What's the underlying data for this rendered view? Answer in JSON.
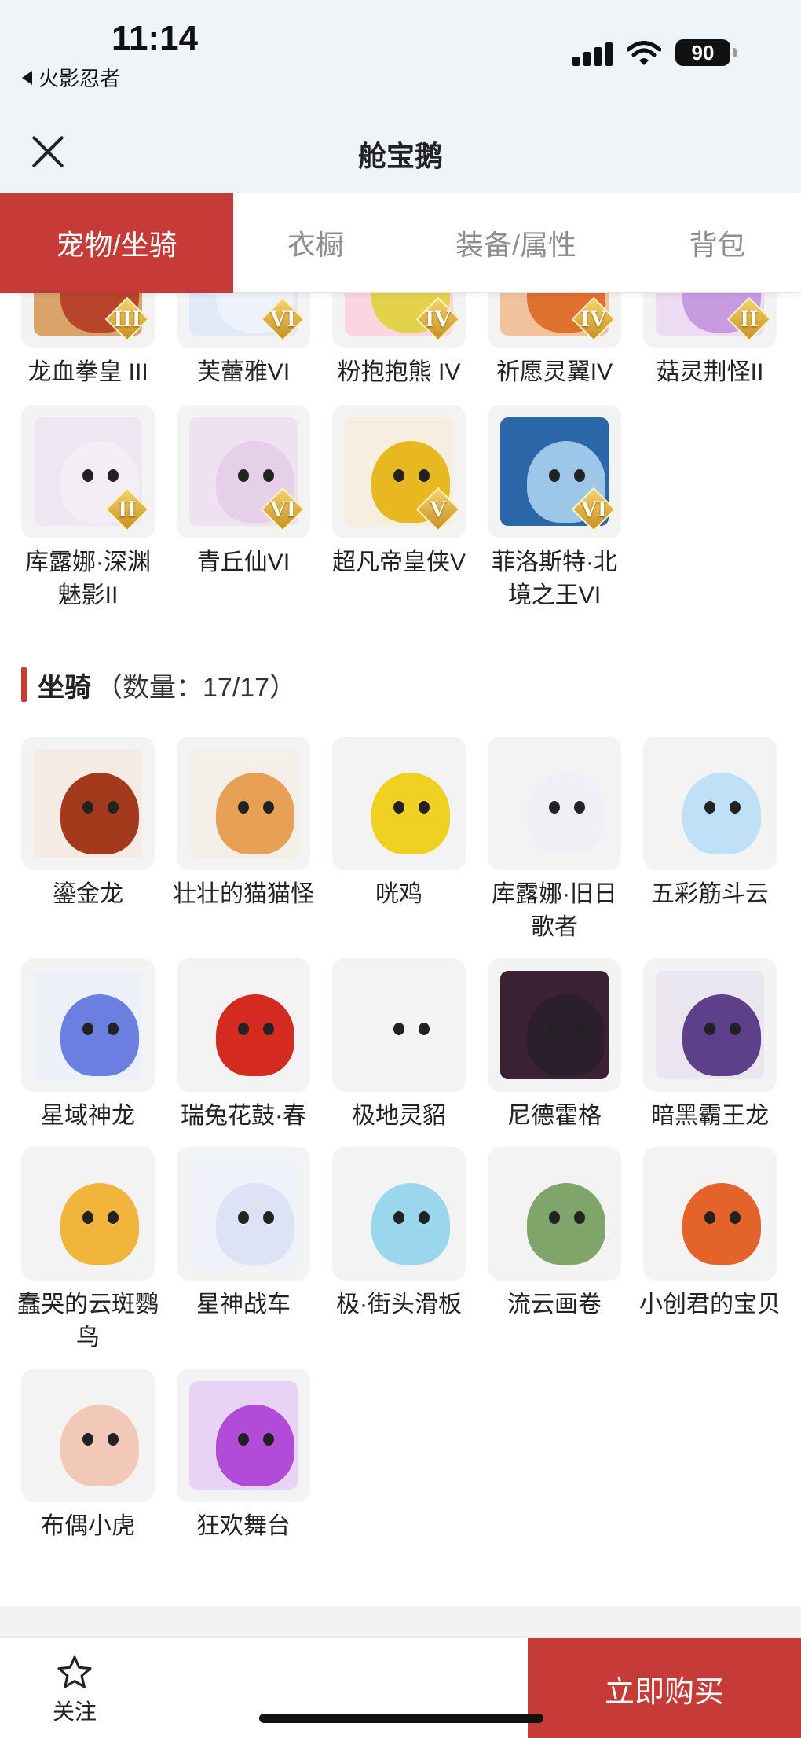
{
  "status": {
    "time": "11:14",
    "back_app": "火影忍者",
    "battery": "90"
  },
  "nav": {
    "title": "舱宝鹅"
  },
  "tabs": [
    {
      "label": "宠物/坐骑",
      "active": true
    },
    {
      "label": "衣橱",
      "active": false
    },
    {
      "label": "装备/属性",
      "active": false
    },
    {
      "label": "背包",
      "active": false
    }
  ],
  "pets": [
    {
      "label": "龙血拳皇 III",
      "tier": "III",
      "icon": "red-beast-icon",
      "bg": "#d9a36a",
      "body": "#b8442c"
    },
    {
      "label": "芙蕾雅VI",
      "tier": "VI",
      "icon": "white-hair-girl-icon",
      "bg": "#dfe9f7",
      "body": "#eef2fb"
    },
    {
      "label": "粉抱抱熊 IV",
      "tier": "IV",
      "icon": "pink-bear-icon",
      "bg": "#fbd6e2",
      "body": "#e3d24a"
    },
    {
      "label": "祈愿灵翼IV",
      "tier": "IV",
      "icon": "orange-bird-icon",
      "bg": "#f1c29c",
      "body": "#e0702e"
    },
    {
      "label": "菇灵荆怪II",
      "tier": "II",
      "icon": "mushroom-creature-icon",
      "bg": "#ecdbf2",
      "body": "#c79be0"
    },
    {
      "label": "库露娜·深渊魅影II",
      "tier": "II",
      "icon": "ghost-girl-icon",
      "bg": "#ede7f3",
      "body": "#f3eef6"
    },
    {
      "label": "青丘仙VI",
      "tier": "VI",
      "icon": "fox-fairy-icon",
      "bg": "#efe1f1",
      "body": "#e6cfe8"
    },
    {
      "label": "超凡帝皇侠V",
      "tier": "V",
      "icon": "golden-armor-icon",
      "bg": "#f6eede",
      "body": "#e7b820"
    },
    {
      "label": "菲洛斯特·北境之王VI",
      "tier": "VI",
      "icon": "ice-king-icon",
      "bg": "#2a66a8",
      "body": "#9cc7e8"
    }
  ],
  "mounts_section": {
    "title": "坐骑",
    "count": "（数量：17/17）"
  },
  "mounts": [
    {
      "label": "鎏金龙",
      "icon": "golden-dragon-icon",
      "bg": "#f3ebe4",
      "body": "#a33a1c"
    },
    {
      "label": "壮壮的猫猫怪",
      "icon": "fat-cat-icon",
      "bg": "#f4efe8",
      "body": "#e8a055"
    },
    {
      "label": "咣鸡",
      "icon": "yellow-chicken-icon",
      "bg": "#f3f3f3",
      "body": "#f0d020"
    },
    {
      "label": "库露娜·旧日歌者",
      "icon": "singer-girl-icon",
      "bg": "#f3f3f3",
      "body": "#eef0f6"
    },
    {
      "label": "五彩筋斗云",
      "icon": "cloud-icon",
      "bg": "#f3f3f3",
      "body": "#bfe0f7"
    },
    {
      "label": "星域神龙",
      "icon": "blue-dragon-icon",
      "bg": "#eef0f8",
      "body": "#6b7fe0"
    },
    {
      "label": "瑞兔花鼓·春",
      "icon": "red-drum-icon",
      "bg": "#f3f3f3",
      "body": "#d42a20"
    },
    {
      "label": "极地灵貂",
      "icon": "white-fox-icon",
      "bg": "#f3f3f3",
      "body": "#f4f4f4"
    },
    {
      "label": "尼德霍格",
      "icon": "dark-dragon-icon",
      "bg": "#3a2232",
      "body": "#2b1f2e"
    },
    {
      "label": "暗黑霸王龙",
      "icon": "purple-trex-icon",
      "bg": "#e9e6ef",
      "body": "#5e3f8a"
    },
    {
      "label": "蠢哭的云斑鹦鸟",
      "icon": "yellow-parrot-icon",
      "bg": "#f3f3f3",
      "body": "#f0b53a"
    },
    {
      "label": "星神战车",
      "icon": "white-horse-icon",
      "bg": "#f0f2fa",
      "body": "#dde3f5"
    },
    {
      "label": "极·街头滑板",
      "icon": "skateboard-icon",
      "bg": "#f3f3f3",
      "body": "#9ad7ec"
    },
    {
      "label": "流云画卷",
      "icon": "bamboo-scroll-icon",
      "bg": "#f3f3f3",
      "body": "#7fa56a"
    },
    {
      "label": "小创君的宝贝",
      "icon": "rainbow-parrot-icon",
      "bg": "#f3f3f3",
      "body": "#e4632a"
    },
    {
      "label": "布偶小虎",
      "icon": "tiger-doll-icon",
      "bg": "#f3f3f3",
      "body": "#f2c9b8"
    },
    {
      "label": "狂欢舞台",
      "icon": "heart-stage-icon",
      "bg": "#e8d3f5",
      "body": "#b24bd8"
    }
  ],
  "bottom": {
    "follow_label": "关注",
    "buy_label": "立即购买"
  }
}
